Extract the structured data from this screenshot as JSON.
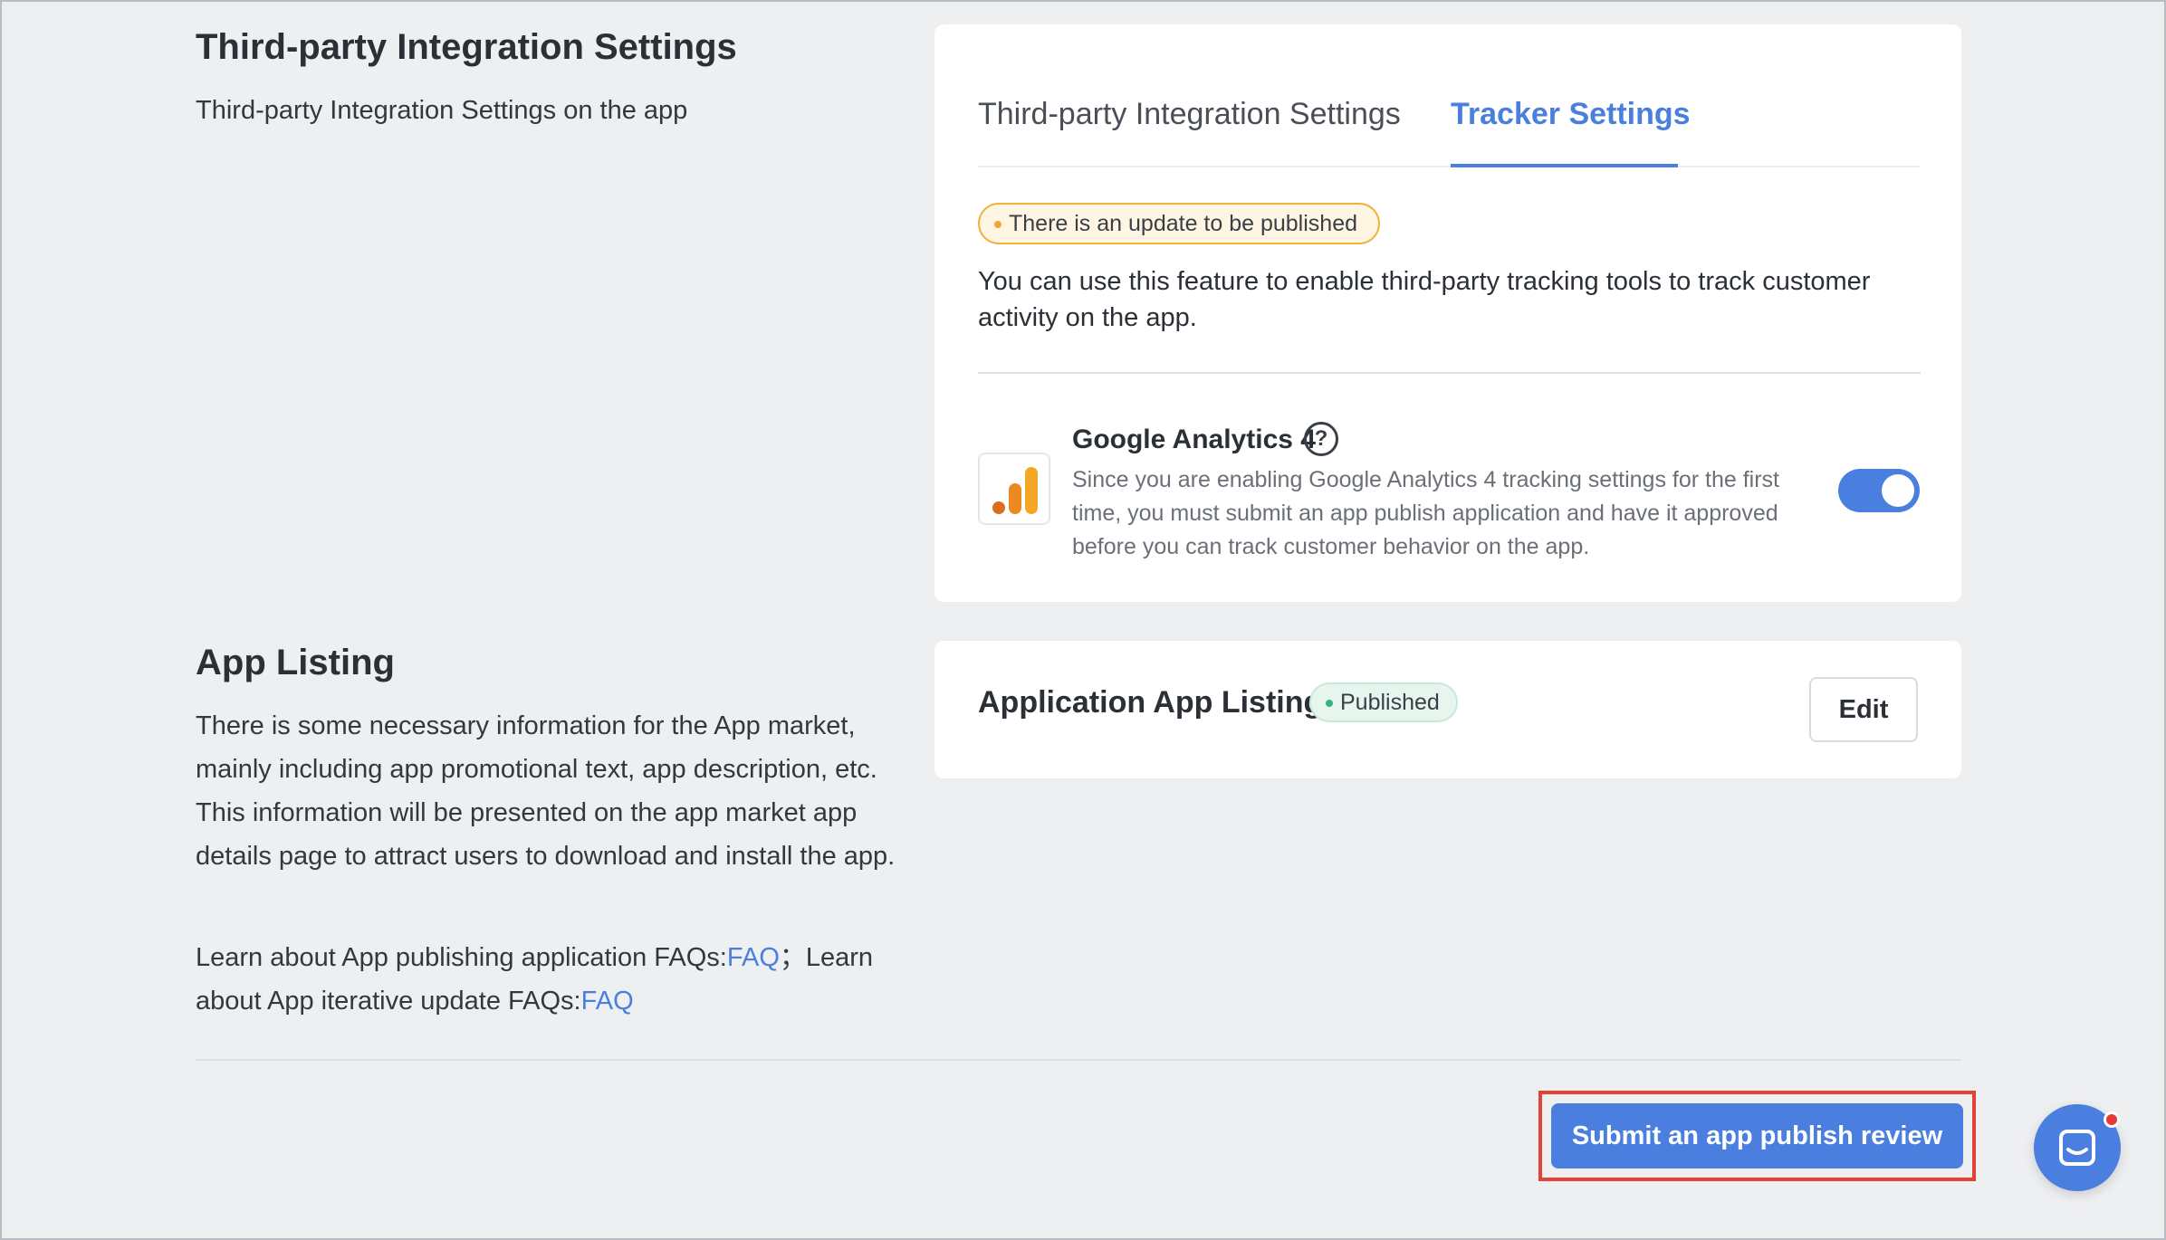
{
  "integration": {
    "title": "Third-party Integration Settings",
    "description": "Third-party Integration Settings on the app",
    "tabs": [
      {
        "label": "Third-party Integration Settings",
        "active": false
      },
      {
        "label": "Tracker Settings",
        "active": true
      }
    ],
    "update_badge": "There is an update to be published",
    "feature_description": "You can use this feature to enable third-party tracking tools to track customer activity on the app.",
    "ga": {
      "title": "Google Analytics 4",
      "help_icon": "?",
      "description": "Since you are enabling Google Analytics 4 tracking settings for the first time, you must submit an app publish application and have it approved before you can track customer behavior on the app.",
      "toggle_on": true
    }
  },
  "app_listing": {
    "title": "App Listing",
    "description": "There is some necessary information for the App market, mainly including app promotional text, app description, etc. This information will be presented on the app market app details page to attract users to download and install the app.",
    "faq_prefix_1": "Learn about App publishing application FAQs:",
    "faq_link_1": "FAQ",
    "faq_separator": "；Learn about App iterative update FAQs:",
    "faq_link_2": "FAQ",
    "card_title": "Application App Listing",
    "status_badge": "Published",
    "edit_label": "Edit"
  },
  "footer": {
    "submit_label": "Submit an app publish review"
  },
  "colors": {
    "accent": "#4a7fe0",
    "warning": "#f1b23c",
    "success": "#34b37b",
    "highlight": "#e04434"
  }
}
